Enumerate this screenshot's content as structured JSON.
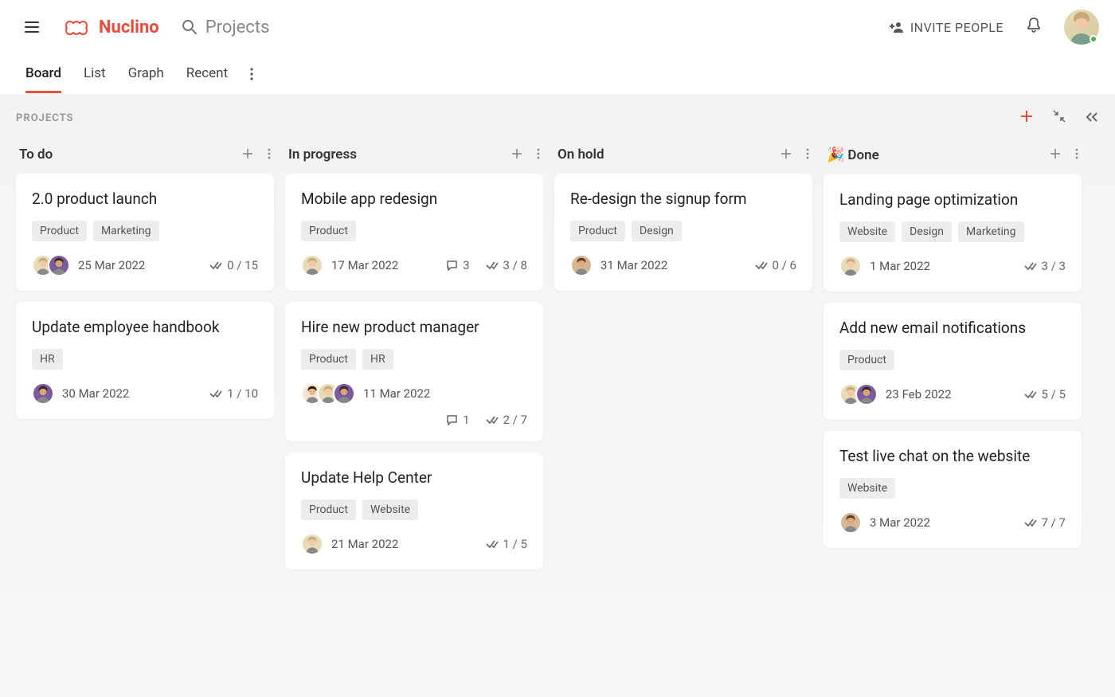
{
  "header": {
    "logo_text": "Nuclino",
    "search_placeholder": "Projects",
    "invite_label": "INVITE PEOPLE"
  },
  "tabs": {
    "items": [
      "Board",
      "List",
      "Graph",
      "Recent"
    ],
    "active": "Board"
  },
  "board": {
    "title": "PROJECTS",
    "columns": [
      {
        "title": "To do",
        "emoji": "",
        "cards": [
          {
            "title": "2.0 product launch",
            "tags": [
              "Product",
              "Marketing"
            ],
            "avatars": [
              "a1",
              "a3"
            ],
            "date": "25 Mar 2022",
            "comments": null,
            "checklist": "0 / 15"
          },
          {
            "title": "Update employee handbook",
            "tags": [
              "HR"
            ],
            "avatars": [
              "a3"
            ],
            "date": "30 Mar 2022",
            "comments": null,
            "checklist": "1 / 10"
          }
        ]
      },
      {
        "title": "In progress",
        "emoji": "",
        "cards": [
          {
            "title": "Mobile app redesign",
            "tags": [
              "Product"
            ],
            "avatars": [
              "a1"
            ],
            "date": "17 Mar 2022",
            "comments": "3",
            "checklist": "3 / 8"
          },
          {
            "title": "Hire new product manager",
            "tags": [
              "Product",
              "HR"
            ],
            "avatars": [
              "a4",
              "a1",
              "a3"
            ],
            "date": "11 Mar 2022",
            "comments": "1",
            "checklist": "2 / 7",
            "two_rows": true
          },
          {
            "title": "Update Help Center",
            "tags": [
              "Product",
              "Website"
            ],
            "avatars": [
              "a1"
            ],
            "date": "21 Mar 2022",
            "comments": null,
            "checklist": "1 / 5"
          }
        ]
      },
      {
        "title": "On hold",
        "emoji": "",
        "cards": [
          {
            "title": "Re-design the signup form",
            "tags": [
              "Product",
              "Design"
            ],
            "avatars": [
              "a5"
            ],
            "date": "31 Mar 2022",
            "comments": null,
            "checklist": "0 / 6"
          }
        ]
      },
      {
        "title": "Done",
        "emoji": "🎉",
        "cards": [
          {
            "title": "Landing page optimization",
            "tags": [
              "Website",
              "Design",
              "Marketing"
            ],
            "avatars": [
              "a1"
            ],
            "date": "1 Mar 2022",
            "comments": null,
            "checklist": "3 / 3"
          },
          {
            "title": "Add new email notifications",
            "tags": [
              "Product"
            ],
            "avatars": [
              "a1",
              "a3"
            ],
            "date": "23 Feb 2022",
            "comments": null,
            "checklist": "5 / 5"
          },
          {
            "title": "Test live chat on the website",
            "tags": [
              "Website"
            ],
            "avatars": [
              "a5"
            ],
            "date": "3 Mar 2022",
            "comments": null,
            "checklist": "7 / 7"
          }
        ]
      }
    ]
  },
  "avatar_colors": {
    "a1": {
      "bg": "#e8dcb8",
      "hair": "#c9a87a",
      "skin": "#f1c9a6"
    },
    "a3": {
      "bg": "#7b5a9e",
      "hair": "#3a2a1a",
      "skin": "#d9a47a"
    },
    "a4": {
      "bg": "#f5e6d3",
      "hair": "#2b1a0f",
      "skin": "#e8b88a"
    },
    "a5": {
      "bg": "#d4b896",
      "hair": "#5a3a2a",
      "skin": "#e0a878"
    }
  }
}
